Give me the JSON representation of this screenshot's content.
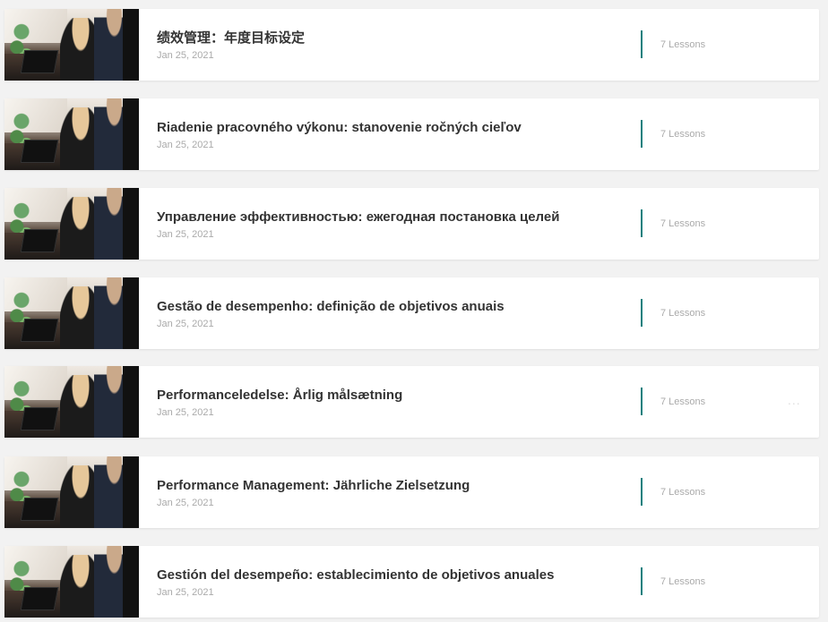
{
  "courses": [
    {
      "title": "绩效管理：年度目标设定",
      "date": "Jan 25, 2021",
      "lessons": "7 Lessons",
      "more": ""
    },
    {
      "title": "Riadenie pracovného výkonu: stanovenie ročných cieľov",
      "date": "Jan 25, 2021",
      "lessons": "7 Lessons",
      "more": ""
    },
    {
      "title": "Управление эффективностью: ежегодная постановка целей",
      "date": "Jan 25, 2021",
      "lessons": "7 Lessons",
      "more": ""
    },
    {
      "title": "Gestão de desempenho: definição de objetivos anuais",
      "date": "Jan 25, 2021",
      "lessons": "7 Lessons",
      "more": ""
    },
    {
      "title": "Performanceledelse: Årlig målsætning",
      "date": "Jan 25, 2021",
      "lessons": "7 Lessons",
      "more": "..."
    },
    {
      "title": "Performance Management: Jährliche Zielsetzung",
      "date": "Jan 25, 2021",
      "lessons": "7 Lessons",
      "more": ""
    },
    {
      "title": "Gestión del desempeño: establecimiento de objetivos anuales",
      "date": "Jan 25, 2021",
      "lessons": "7 Lessons",
      "more": ""
    }
  ],
  "accent_color": "#14807e"
}
